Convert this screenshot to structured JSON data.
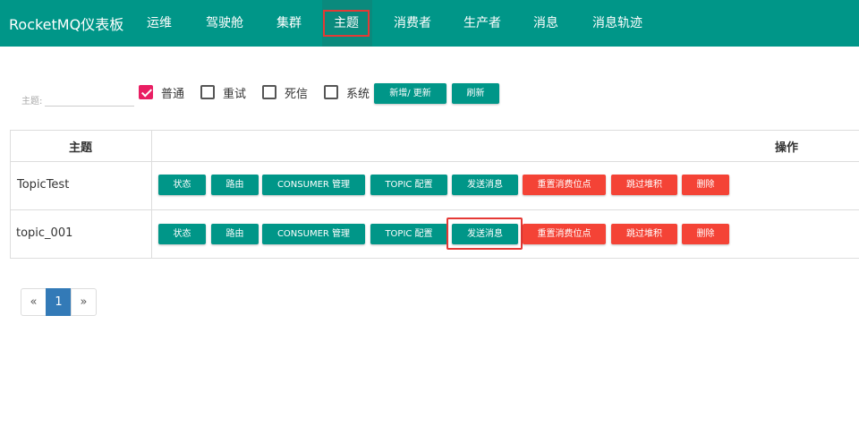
{
  "nav": {
    "brand": "RocketMQ仪表板",
    "items": [
      {
        "label": "运维"
      },
      {
        "label": "驾驶舱"
      },
      {
        "label": "集群"
      },
      {
        "label": "主题"
      },
      {
        "label": "消费者"
      },
      {
        "label": "生产者"
      },
      {
        "label": "消息"
      },
      {
        "label": "消息轨迹"
      }
    ],
    "active": "主题"
  },
  "filter": {
    "topic_label": "主题:",
    "topic_value": "",
    "checkboxes": [
      {
        "label": "普通",
        "checked": true
      },
      {
        "label": "重试",
        "checked": false
      },
      {
        "label": "死信",
        "checked": false
      },
      {
        "label": "系统",
        "checked": false
      }
    ],
    "add_update_label": "新增/ 更新",
    "refresh_label": "刷新"
  },
  "table": {
    "headers": {
      "topic": "主题",
      "actions": "操作"
    },
    "action_labels": {
      "status": "状态",
      "route": "路由",
      "consumer_manage": "CONSUMER 管理",
      "topic_config": "TOPIC 配置",
      "send_message": "发送消息",
      "reset_offset": "重置消费位点",
      "skip_accumulate": "跳过堆积",
      "delete": "删除"
    },
    "rows": [
      {
        "topic": "TopicTest"
      },
      {
        "topic": "topic_001"
      }
    ]
  },
  "pagination": {
    "prev": "«",
    "current": "1",
    "next": "»"
  },
  "colors": {
    "primary": "#009688",
    "danger": "#f44336",
    "highlight": "#e53935",
    "checkbox": "#e91e63",
    "page_active": "#337ab7"
  }
}
